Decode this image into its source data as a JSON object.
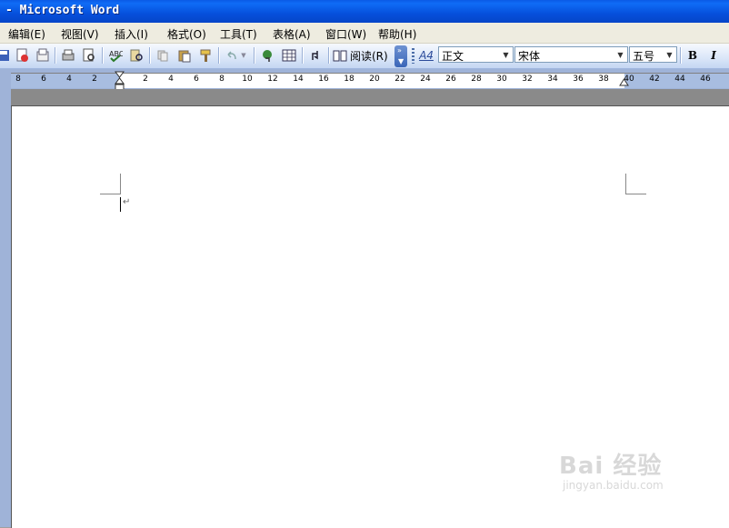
{
  "window": {
    "title": "- Microsoft Word"
  },
  "menubar": {
    "items": [
      "编辑(E)",
      "视图(V)",
      "插入(I)",
      "格式(O)",
      "工具(T)",
      "表格(A)",
      "窗口(W)",
      "帮助(H)"
    ]
  },
  "toolbar": {
    "read_label": "阅读(R)",
    "style_value": "正文",
    "font_value": "宋体",
    "size_value": "五号",
    "bold_label": "B",
    "italic_label": "I",
    "styles_icon_label": "A4"
  },
  "ruler": {
    "labels": [
      "8",
      "6",
      "4",
      "2",
      "2",
      "4",
      "6",
      "8",
      "10",
      "12",
      "14",
      "16",
      "18",
      "20",
      "22",
      "24",
      "26",
      "28",
      "30",
      "32",
      "34",
      "36",
      "38",
      "40",
      "42",
      "44",
      "46"
    ]
  },
  "document": {
    "paragraph_mark": "↵"
  },
  "watermark": {
    "main": "Bai 经验",
    "sub": "jingyan.baidu.com"
  },
  "colors": {
    "title_bar": "#0650dc",
    "menu_bg": "#eeece0",
    "toolbar_bg": "#dae6f8"
  }
}
